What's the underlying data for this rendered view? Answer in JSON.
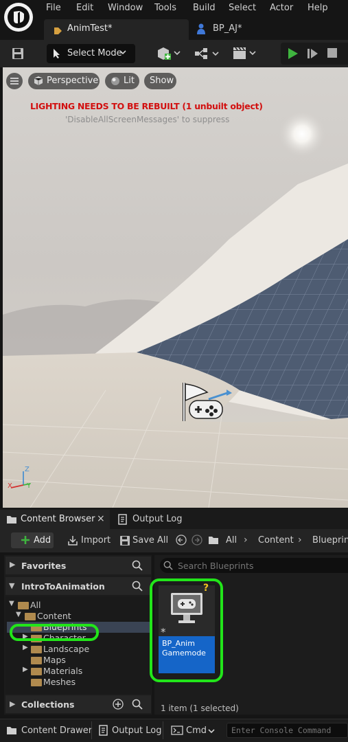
{
  "menu": {
    "items": [
      "File",
      "Edit",
      "Window",
      "Tools",
      "Build",
      "Select",
      "Actor",
      "Help"
    ]
  },
  "tabs": [
    {
      "label": "AnimTest*"
    },
    {
      "label": "BP_AJ*"
    }
  ],
  "toolbar": {
    "select_mode_label": "Select Mode"
  },
  "viewport": {
    "perspective_label": "Perspective",
    "lit_label": "Lit",
    "show_label": "Show",
    "warning": "LIGHTING NEEDS TO BE REBUILT (1 unbuilt object)",
    "suppress_message": "'DisableAllScreenMessages' to suppress",
    "axis_labels": {
      "z": "Z",
      "x": "X",
      "y": "Y"
    }
  },
  "content_browser": {
    "tab_label": "Content Browser",
    "output_log_tab_label": "Output Log",
    "add_label": "Add",
    "import_label": "Import",
    "save_all_label": "Save All",
    "breadcrumb": [
      "All",
      "Content",
      "Blueprints"
    ],
    "favorites_label": "Favorites",
    "project_label": "IntroToAnimation",
    "collections_label": "Collections",
    "search_placeholder": "Search Blueprints",
    "tree": [
      {
        "label": "All"
      },
      {
        "label": "Content"
      },
      {
        "label": "Blueprints"
      },
      {
        "label": "Character"
      },
      {
        "label": "Landscape"
      },
      {
        "label": "Maps"
      },
      {
        "label": "Materials"
      },
      {
        "label": "Meshes"
      }
    ],
    "asset": {
      "name": "BP_Anim Gamemode",
      "badge": "?"
    },
    "status": "1 item (1 selected)"
  },
  "statusbar": {
    "content_drawer_label": "Content Drawer",
    "output_log_label": "Output Log",
    "cmd_label": "Cmd",
    "console_placeholder": "Enter Console Command"
  },
  "colors": {
    "highlight": "#22e51a",
    "selection": "#1565c8",
    "warning": "#d21010",
    "play": "#3fb43f"
  }
}
